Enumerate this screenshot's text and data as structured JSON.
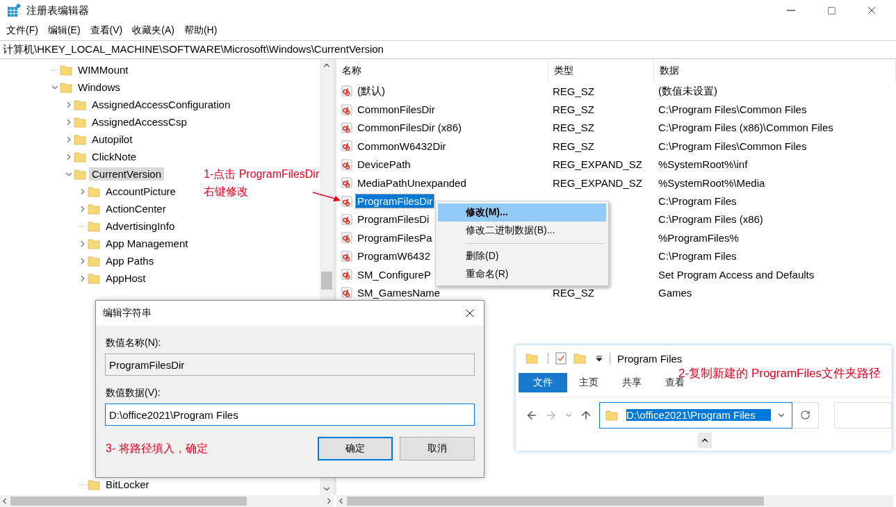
{
  "window": {
    "title": "注册表编辑器"
  },
  "menu": [
    "文件(F)",
    "编辑(E)",
    "查看(V)",
    "收藏夹(A)",
    "帮助(H)"
  ],
  "address": "计算机\\HKEY_LOCAL_MACHINE\\SOFTWARE\\Microsoft\\Windows\\CurrentVersion",
  "tree": [
    {
      "name": "WIMMount",
      "expandable": false,
      "selected": false
    },
    {
      "name": "Windows",
      "expandable": true,
      "expanded": true,
      "selected": false,
      "children": [
        {
          "name": "AssignedAccessConfiguration",
          "expandable": true,
          "expanded": false,
          "selected": false
        },
        {
          "name": "AssignedAccessCsp",
          "expandable": true,
          "expanded": false,
          "selected": false
        },
        {
          "name": "Autopilot",
          "expandable": true,
          "expanded": false,
          "selected": false
        },
        {
          "name": "ClickNote",
          "expandable": true,
          "expanded": false,
          "selected": false
        },
        {
          "name": "CurrentVersion",
          "expandable": true,
          "expanded": true,
          "selected": true,
          "children": [
            {
              "name": "AccountPicture",
              "expandable": true,
              "expanded": false,
              "selected": false
            },
            {
              "name": "ActionCenter",
              "expandable": true,
              "expanded": false,
              "selected": false
            },
            {
              "name": "AdvertisingInfo",
              "expandable": false,
              "selected": false
            },
            {
              "name": "App Management",
              "expandable": true,
              "expanded": false,
              "selected": false
            },
            {
              "name": "App Paths",
              "expandable": true,
              "expanded": false,
              "selected": false
            },
            {
              "name": "AppHost",
              "expandable": true,
              "expanded": false,
              "selected": false
            },
            {
              "name": "BitLocker",
              "expandable": false,
              "selected": false
            }
          ]
        }
      ]
    }
  ],
  "values": {
    "columns": [
      "名称",
      "类型",
      "数据"
    ],
    "rows": [
      {
        "name": "(默认)",
        "type": "REG_SZ",
        "data": "(数值未设置)",
        "selected": false
      },
      {
        "name": "CommonFilesDir",
        "type": "REG_SZ",
        "data": "C:\\Program Files\\Common Files",
        "selected": false
      },
      {
        "name": "CommonFilesDir (x86)",
        "type": "REG_SZ",
        "data": "C:\\Program Files (x86)\\Common Files",
        "selected": false
      },
      {
        "name": "CommonW6432Dir",
        "type": "REG_SZ",
        "data": "C:\\Program Files\\Common Files",
        "selected": false
      },
      {
        "name": "DevicePath",
        "type": "REG_EXPAND_SZ",
        "data": "%SystemRoot%\\inf",
        "selected": false
      },
      {
        "name": "MediaPathUnexpanded",
        "type": "REG_EXPAND_SZ",
        "data": "%SystemRoot%\\Media",
        "selected": false
      },
      {
        "name": "ProgramFilesDir",
        "data": "C:\\Program Files",
        "selected": true
      },
      {
        "name": "ProgramFilesDi",
        "data": "C:\\Program Files (x86)",
        "selected": false
      },
      {
        "name": "ProgramFilesPa",
        "data": "%ProgramFiles%",
        "selected": false
      },
      {
        "name": "ProgramW6432",
        "data": "C:\\Program Files",
        "selected": false
      },
      {
        "name": "SM_ConfigureP",
        "data": "Set Program Access and Defaults",
        "selected": false
      },
      {
        "name": "SM_GamesName",
        "type": "REG_SZ",
        "data": "Games",
        "selected": false
      }
    ]
  },
  "context_menu": {
    "groups": [
      [
        {
          "label": "修改(M)...",
          "selected": true,
          "default": true
        },
        {
          "label": "修改二进制数据(B)...",
          "selected": false,
          "default": false
        }
      ],
      [
        {
          "label": "删除(D)",
          "selected": false,
          "default": false
        },
        {
          "label": "重命名(R)",
          "selected": false,
          "default": false
        }
      ]
    ]
  },
  "callout": [
    "1-点击 ProgramFilesDir",
    "右键修改"
  ],
  "dialog": {
    "title": "编辑字符串",
    "name_label": "数值名称(N):",
    "name_value": "ProgramFilesDir",
    "data_label": "数值数据(V):",
    "data_value": "D:\\office2021\\Program Files",
    "annotation": "3- 将路径填入，确定",
    "buttons": [
      {
        "label": "确定",
        "default": true
      },
      {
        "label": "取消",
        "default": false
      }
    ]
  },
  "explorer": {
    "title": "Program Files",
    "annotation": "2-复制新建的 ProgramFiles文件夹路径",
    "tabs": [
      {
        "label": "文件",
        "selected": true
      },
      {
        "label": "主页",
        "selected": false
      },
      {
        "label": "共享",
        "selected": false
      },
      {
        "label": "查看",
        "selected": false
      }
    ],
    "path": "D:\\office2021\\Program Files",
    "path_selected": true
  }
}
